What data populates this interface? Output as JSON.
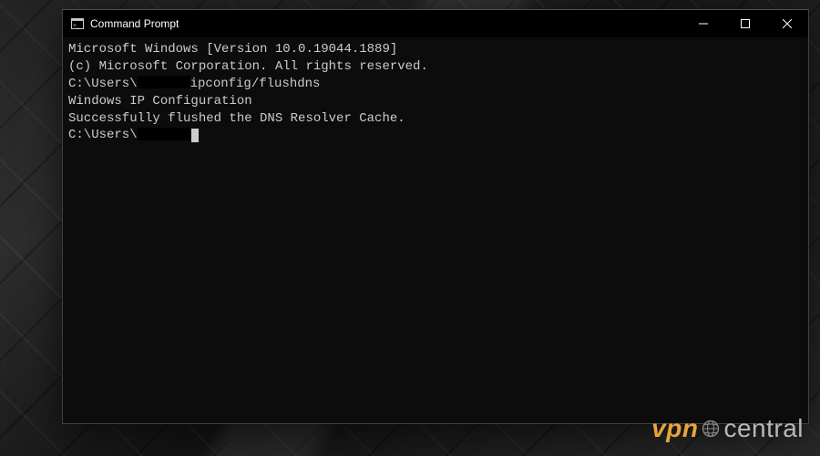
{
  "window": {
    "title": "Command Prompt"
  },
  "terminal": {
    "line1": "Microsoft Windows [Version 10.0.19044.1889]",
    "line2": "(c) Microsoft Corporation. All rights reserved.",
    "prompt_prefix": "C:\\Users\\",
    "command": "ipconfig/flushdns",
    "blank": "",
    "heading": "Windows IP Configuration",
    "result": "Successfully flushed the DNS Resolver Cache."
  },
  "watermark": {
    "part1": "vpn",
    "part2": "central"
  }
}
